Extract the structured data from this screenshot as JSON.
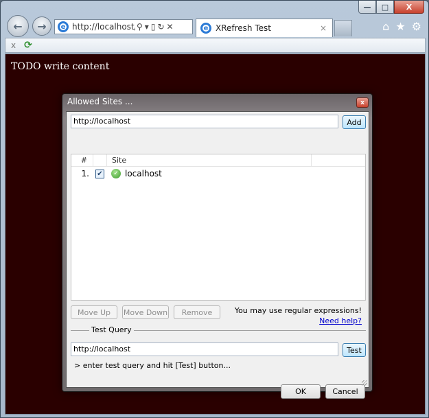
{
  "browser": {
    "address": {
      "url": "http://localhost/",
      "search_icon": "search-icon",
      "dropdown_icon": "chevron-down-icon",
      "compat_icon": "compat-view-icon",
      "refresh_icon": "refresh-icon",
      "stop_icon": "close-icon"
    },
    "tab": {
      "title": "XRefresh Test",
      "close": "×"
    },
    "window_buttons": {
      "minimize": "—",
      "maximize": "□",
      "close": "X"
    },
    "nav": {
      "back": "←",
      "forward": "→"
    },
    "commandbar": {
      "close": "x",
      "refresh": "⟳"
    },
    "right_icons": {
      "home": "⌂",
      "favorites": "★",
      "tools": "⚙"
    }
  },
  "page": {
    "text": "TODO write content"
  },
  "dialog": {
    "title": "Allowed Sites ...",
    "close": "x",
    "site_input": {
      "value": "http://localhost"
    },
    "add_label": "Add",
    "columns": {
      "num": "#",
      "site": "Site"
    },
    "rows": [
      {
        "num": "1.",
        "checked": "✔",
        "site": "localhost"
      }
    ],
    "buttons": {
      "move_up": "Move Up",
      "move_down": "Move Down",
      "remove": "Remove"
    },
    "hint": "You may use regular expressions!",
    "help_link": "Need help?",
    "test_query": {
      "label": "Test Query",
      "value": "http://localhost",
      "button": "Test",
      "message": "> enter test query and hit [Test] button..."
    },
    "ok_label": "OK",
    "cancel_label": "Cancel"
  }
}
